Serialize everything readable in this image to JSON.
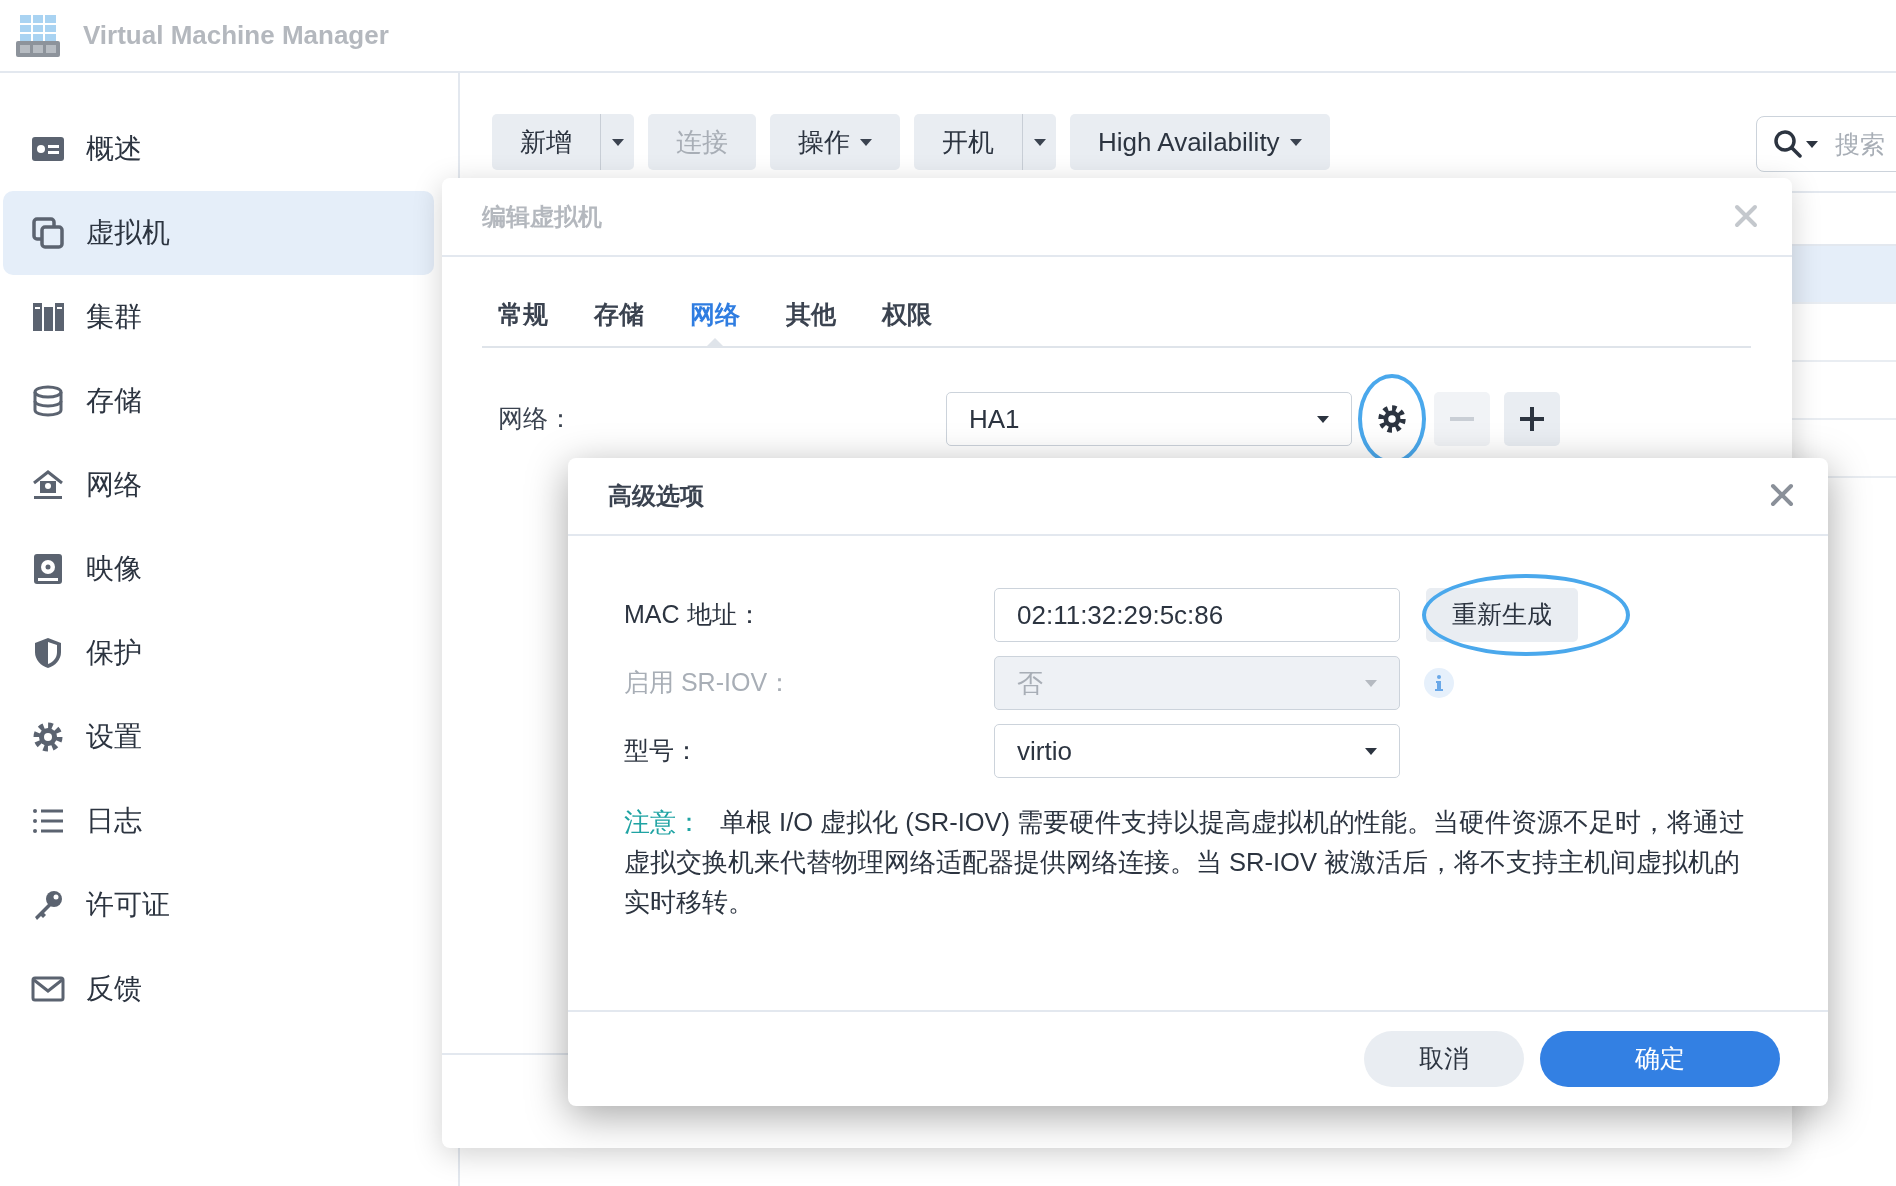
{
  "app": {
    "title": "Virtual Machine Manager"
  },
  "sidebar": {
    "items": [
      {
        "label": "概述",
        "kind": "overview",
        "selected": false
      },
      {
        "label": "虚拟机",
        "kind": "vm",
        "selected": true
      },
      {
        "label": "集群",
        "kind": "cluster",
        "selected": false
      },
      {
        "label": "存储",
        "kind": "storage",
        "selected": false
      },
      {
        "label": "网络",
        "kind": "network",
        "selected": false
      },
      {
        "label": "映像",
        "kind": "image",
        "selected": false
      },
      {
        "label": "保护",
        "kind": "protect",
        "selected": false
      },
      {
        "label": "设置",
        "kind": "settings",
        "selected": false
      },
      {
        "label": "日志",
        "kind": "log",
        "selected": false
      },
      {
        "label": "许可证",
        "kind": "license",
        "selected": false
      },
      {
        "label": "反馈",
        "kind": "feedback",
        "selected": false
      }
    ]
  },
  "toolbar": {
    "buttons": [
      {
        "label": "新增",
        "disabled": false,
        "kind": "split"
      },
      {
        "label": "连接",
        "disabled": true,
        "kind": "plain"
      },
      {
        "label": "操作",
        "disabled": false,
        "kind": "menu"
      },
      {
        "label": "开机",
        "disabled": false,
        "kind": "split"
      },
      {
        "label": "High Availability",
        "disabled": false,
        "kind": "menu"
      }
    ],
    "search": {
      "placeholder": "搜索"
    }
  },
  "table": {
    "rows": [
      {
        "selected": true
      },
      {
        "selected": false
      },
      {
        "selected": false
      },
      {
        "selected": false
      }
    ]
  },
  "edit_dialog": {
    "title": "编辑虚拟机",
    "tabs": [
      {
        "label": "常规",
        "selected": false
      },
      {
        "label": "存储",
        "selected": false
      },
      {
        "label": "网络",
        "selected": true
      },
      {
        "label": "其他",
        "selected": false
      },
      {
        "label": "权限",
        "selected": false
      }
    ],
    "network": {
      "label": "网络：",
      "value": "HA1",
      "gear_highlighted": true,
      "remove_disabled": true
    }
  },
  "advanced_dialog": {
    "title": "高级选项",
    "fields": [
      {
        "kind": "text",
        "label": "MAC 地址：",
        "value": "02:11:32:29:5c:86",
        "disabled": false
      },
      {
        "kind": "select",
        "label": "启用 SR-IOV：",
        "value": "否",
        "disabled": true,
        "info": true
      },
      {
        "kind": "select",
        "label": "型号：",
        "value": "virtio",
        "disabled": false,
        "info": false
      }
    ],
    "regenerate": {
      "label": "重新生成",
      "highlighted": true
    },
    "note": {
      "label": "注意：",
      "text": "单根 I/O 虚拟化 (SR-IOV) 需要硬件支持以提高虚拟机的性能。当硬件资源不足时，将通过虚拟交换机来代替物理网络适配器提供网络连接。当 SR-IOV 被激活后，将不支持主机间虚拟机的实时移转。"
    },
    "buttons": [
      {
        "label": "取消",
        "kind": "secondary"
      },
      {
        "label": "确定",
        "kind": "primary"
      }
    ]
  }
}
